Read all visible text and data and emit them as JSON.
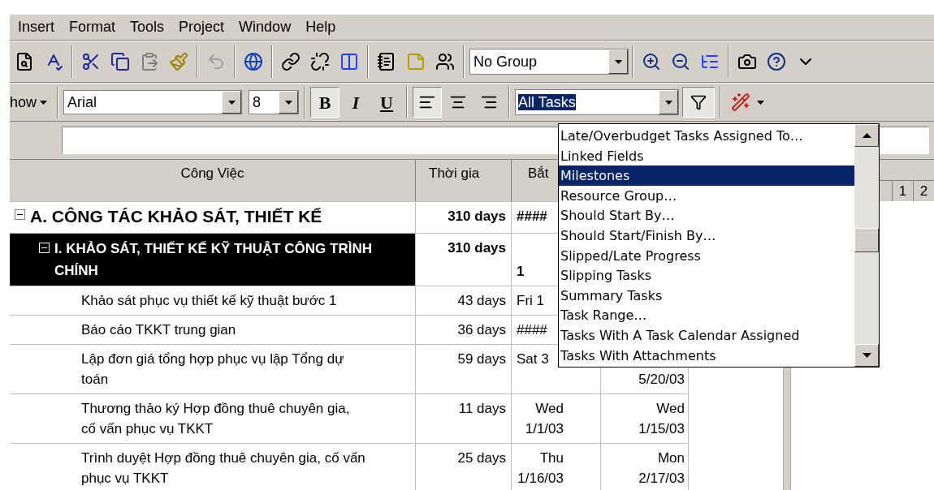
{
  "menu": [
    "Insert",
    "Format",
    "Tools",
    "Project",
    "Window",
    "Help"
  ],
  "toolbar": {
    "group_combo": {
      "value": "No Group"
    }
  },
  "format_bar": {
    "show_button": "how",
    "font": "Arial",
    "size": "8",
    "style_buttons": [
      {
        "label": "B",
        "pressed": true
      },
      {
        "label": "I",
        "pressed": false
      },
      {
        "label": "U",
        "pressed": false
      }
    ],
    "align_buttons": [
      {
        "kind": "left",
        "pressed": true
      },
      {
        "kind": "center",
        "pressed": false
      },
      {
        "kind": "right",
        "pressed": false
      }
    ],
    "filter": {
      "value": "All Tasks",
      "autofilter_pressed": true
    }
  },
  "filter_list": {
    "items": [
      {
        "label": "Late/Overbudget Tasks Assigned To…",
        "selected": false
      },
      {
        "label": "Linked Fields",
        "selected": false
      },
      {
        "label": "Milestones",
        "selected": true
      },
      {
        "label": "Resource Group…",
        "selected": false
      },
      {
        "label": "Should Start By…",
        "selected": false
      },
      {
        "label": "Should Start/Finish By…",
        "selected": false
      },
      {
        "label": "Slipped/Late Progress",
        "selected": false
      },
      {
        "label": "Slipping Tasks",
        "selected": false
      },
      {
        "label": "Summary Tasks",
        "selected": false
      },
      {
        "label": "Task Range…",
        "selected": false
      },
      {
        "label": "Tasks With A Task Calendar Assigned",
        "selected": false
      },
      {
        "label": "Tasks With Attachments",
        "selected": false
      }
    ]
  },
  "table": {
    "columns": [
      "Công Việc",
      "Thời gia",
      "Bắt"
    ],
    "rows": [
      {
        "kind": "phase",
        "expanded": true,
        "name": "A. CÔNG TÁC KHẢO SÁT, THIẾT KẾ",
        "duration": "310 days",
        "start": "####"
      },
      {
        "kind": "group",
        "expanded": true,
        "name": "I. KHẢO SÁT, THIẾT KẾ KỸ THUẬT CÔNG TRÌNH CHÍNH",
        "duration": "310 days",
        "start": "1"
      },
      {
        "kind": "task",
        "name": "Khảo sát phục vụ thiết kế kỹ thuật bước 1",
        "duration": "43 days",
        "start": "Fri 1"
      },
      {
        "kind": "task",
        "name": "Báo cáo TKKT trung gian",
        "duration": "36 days",
        "start": "####"
      },
      {
        "kind": "task",
        "name": "Lập đơn giá tổng hợp phục vụ lập Tổng dự toán",
        "duration": "59 days",
        "start": "Sat 3",
        "finish": "5/20/03"
      },
      {
        "kind": "task",
        "name": "Thương thảo ký Hợp đồng thuê chuyên gia, cố vấn phục vụ TKKT",
        "duration": "11 days",
        "start": "Wed 1/1/03",
        "finish": "Wed 1/15/03"
      },
      {
        "kind": "task",
        "name": "Trình duyệt Hợp đồng thuê chuyên gia, cố vấn phục vụ TKKT",
        "duration": "25 days",
        "start": "Thu 1/16/03",
        "finish": "Mon 2/17/03"
      }
    ]
  },
  "gantt": {
    "timescale": [
      "1",
      "2"
    ]
  }
}
